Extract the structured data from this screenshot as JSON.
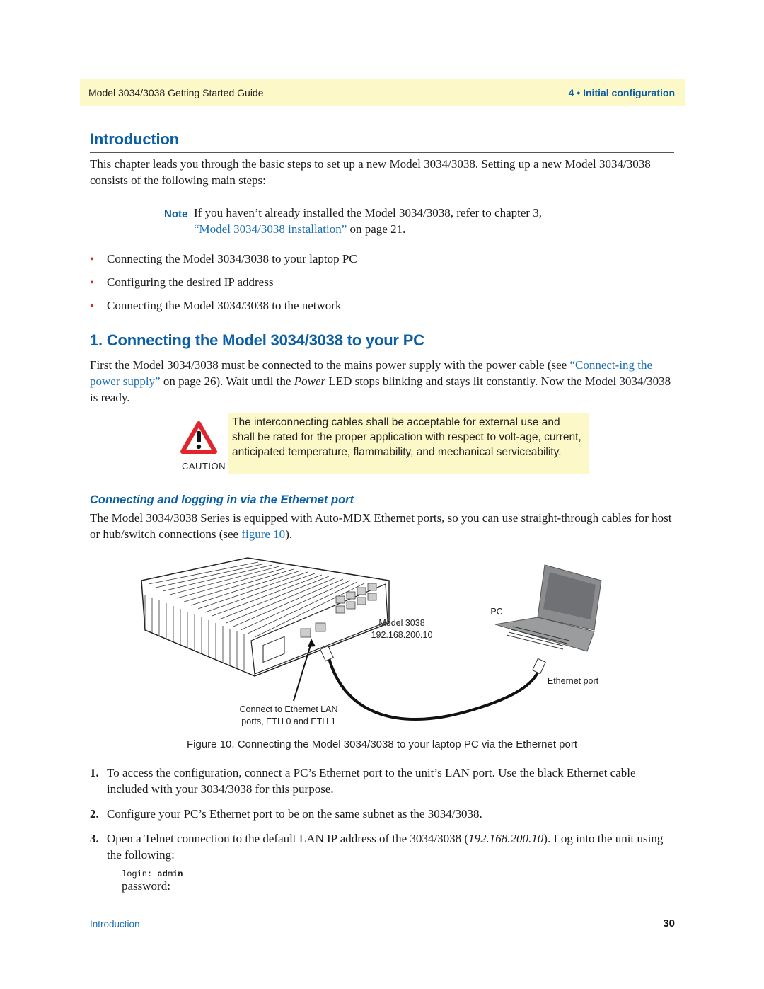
{
  "header": {
    "guide_title": "Model 3034/3038 Getting Started Guide",
    "chapter": "4 • Initial configuration"
  },
  "intro": {
    "title": "Introduction",
    "paragraph": "This chapter leads you through the basic steps to set up a new Model 3034/3038. Setting up a new Model 3034/3038 consists of the following main steps:",
    "note": {
      "label": "Note",
      "text_before": "If you haven’t already installed the Model 3034/3038, refer to chapter 3,",
      "link": "“Model 3034/3038 installation”",
      "text_after": " on page 21."
    },
    "bullets": [
      "Connecting the Model 3034/3038 to your laptop PC",
      "Configuring the desired IP address",
      "Connecting the Model 3034/3038 to the network"
    ]
  },
  "section1": {
    "title": "1. Connecting the Model 3034/3038 to your PC",
    "para_start": "First the Model 3034/3038 must be connected to the mains power supply with the power cable (see ",
    "para_link": "“Connect-ing the power supply”",
    "para_mid": " on page 26). Wait until the ",
    "para_italic": "Power",
    "para_end": " LED stops blinking and stays lit constantly. Now the Model 3034/3038 is ready.",
    "caution": {
      "label": "CAUTION",
      "text": "The interconnecting cables shall be acceptable for external use and shall be rated for the proper application with respect to volt-age, current, anticipated temperature, flammability, and mechanical serviceability."
    }
  },
  "subsection": {
    "title": "Connecting and logging in via the Ethernet port",
    "para_start": "The Model 3034/3038 Series is equipped with Auto-MDX Ethernet ports, so you can use straight-through cables for host or hub/switch connections (see ",
    "para_link": "figure 10",
    "para_end": ")."
  },
  "figure": {
    "device_label": "Model 3038",
    "device_ip": "192.168.200.10",
    "pc_label": "PC",
    "port_label": "Ethernet port",
    "callout_line1": "Connect to Ethernet LAN",
    "callout_line2": "ports, ETH 0 and ETH 1",
    "caption": "Figure 10. Connecting the Model 3034/3038 to your laptop PC via the Ethernet port"
  },
  "steps": [
    {
      "num": "1.",
      "text": "To access the configuration, connect a PC’s Ethernet port to the unit’s LAN port. Use the black Ethernet cable included with your 3034/3038 for this purpose."
    },
    {
      "num": "2.",
      "text": "Configure your PC’s Ethernet port to be on the same subnet as the 3034/3038."
    },
    {
      "num": "3.",
      "text_before": "Open a Telnet connection to the default LAN IP address of the 3034/3038 (",
      "ip": "192.168.200.10",
      "text_after": "). Log into the unit using the following:"
    }
  ],
  "login": {
    "login_label": "login: ",
    "login_value": "admin",
    "password_label": "password:"
  },
  "footer": {
    "section": "Introduction",
    "page": "30"
  }
}
